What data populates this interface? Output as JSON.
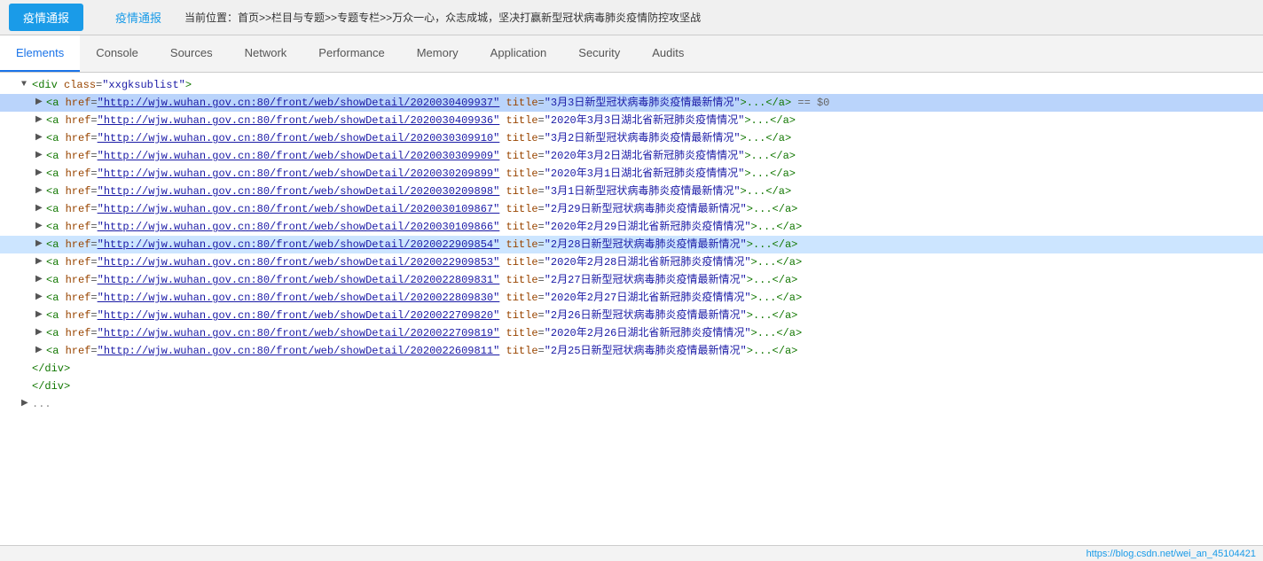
{
  "browser": {
    "tab_active_label": "疫情通报",
    "tab_inactive_label": "疫情通报",
    "breadcrumb": "当前位置：首页>>栏目与专题>>专题专栏>>万众一心，众志成城，坚决打赢新型冠状病毒肺炎疫情防控攻坚战"
  },
  "devtools": {
    "tabs": [
      {
        "id": "elements",
        "label": "Elements",
        "active": true
      },
      {
        "id": "console",
        "label": "Console",
        "active": false
      },
      {
        "id": "sources",
        "label": "Sources",
        "active": false
      },
      {
        "id": "network",
        "label": "Network",
        "active": false
      },
      {
        "id": "performance",
        "label": "Performance",
        "active": false
      },
      {
        "id": "memory",
        "label": "Memory",
        "active": false
      },
      {
        "id": "application",
        "label": "Application",
        "active": false
      },
      {
        "id": "security",
        "label": "Security",
        "active": false
      },
      {
        "id": "audits",
        "label": "Audits",
        "active": false
      }
    ]
  },
  "dom": {
    "lines": [
      {
        "indent": 1,
        "triangle": "open",
        "html": "<span class='tag-bracket'>&lt;</span><span class='tag'>div</span> <span class='attr-name'>class</span><span class='equals-sign'>=</span><span class='attr-value'>\"xxgksublist\"</span><span class='tag-bracket'>&gt;</span>",
        "selected": false
      },
      {
        "indent": 2,
        "triangle": "closed",
        "html": "<span class='tag-bracket'>&lt;</span><span class='tag'>a</span> <span class='attr-name'>href</span><span class='equals-sign'>=</span><span class='attr-value-link'>\"http://wjw.wuhan.gov.cn:80/front/web/showDetail/2020030409937\"</span> <span class='attr-name'>title</span><span class='equals-sign'>=</span><span class='attr-value'>\"3月3日新型冠状病毒肺炎疫情最新情况\"</span><span class='tag-bracket'>&gt;...&lt;/</span><span class='tag'>a</span><span class='tag-bracket'>&gt;</span> <span class='equals-dollar'>== $0</span>",
        "selected": true
      },
      {
        "indent": 2,
        "triangle": "closed",
        "html": "<span class='tag-bracket'>&lt;</span><span class='tag'>a</span> <span class='attr-name'>href</span><span class='equals-sign'>=</span><span class='attr-value-link'>\"http://wjw.wuhan.gov.cn:80/front/web/showDetail/2020030409936\"</span> <span class='attr-name'>title</span><span class='equals-sign'>=</span><span class='attr-value'>\"2020年3月3日湖北省新冠肺炎疫情情况\"</span><span class='tag-bracket'>&gt;...&lt;/</span><span class='tag'>a</span><span class='tag-bracket'>&gt;</span>",
        "selected": false
      },
      {
        "indent": 2,
        "triangle": "closed",
        "html": "<span class='tag-bracket'>&lt;</span><span class='tag'>a</span> <span class='attr-name'>href</span><span class='equals-sign'>=</span><span class='attr-value-link'>\"http://wjw.wuhan.gov.cn:80/front/web/showDetail/2020030309910\"</span> <span class='attr-name'>title</span><span class='equals-sign'>=</span><span class='attr-value'>\"3月2日新型冠状病毒肺炎疫情最新情况\"</span><span class='tag-bracket'>&gt;...&lt;/</span><span class='tag'>a</span><span class='tag-bracket'>&gt;</span>",
        "selected": false
      },
      {
        "indent": 2,
        "triangle": "closed",
        "html": "<span class='tag-bracket'>&lt;</span><span class='tag'>a</span> <span class='attr-name'>href</span><span class='equals-sign'>=</span><span class='attr-value-link'>\"http://wjw.wuhan.gov.cn:80/front/web/showDetail/2020030309909\"</span> <span class='attr-name'>title</span><span class='equals-sign'>=</span><span class='attr-value'>\"2020年3月2日湖北省新冠肺炎疫情情况\"</span><span class='tag-bracket'>&gt;...&lt;/</span><span class='tag'>a</span><span class='tag-bracket'>&gt;</span>",
        "selected": false
      },
      {
        "indent": 2,
        "triangle": "closed",
        "html": "<span class='tag-bracket'>&lt;</span><span class='tag'>a</span> <span class='attr-name'>href</span><span class='equals-sign'>=</span><span class='attr-value-link'>\"http://wjw.wuhan.gov.cn:80/front/web/showDetail/2020030209899\"</span> <span class='attr-name'>title</span><span class='equals-sign'>=</span><span class='attr-value'>\"2020年3月1日湖北省新冠肺炎疫情情况\"</span><span class='tag-bracket'>&gt;...&lt;/</span><span class='tag'>a</span><span class='tag-bracket'>&gt;</span>",
        "selected": false
      },
      {
        "indent": 2,
        "triangle": "closed",
        "html": "<span class='tag-bracket'>&lt;</span><span class='tag'>a</span> <span class='attr-name'>href</span><span class='equals-sign'>=</span><span class='attr-value-link'>\"http://wjw.wuhan.gov.cn:80/front/web/showDetail/2020030209898\"</span> <span class='attr-name'>title</span><span class='equals-sign'>=</span><span class='attr-value'>\"3月1日新型冠状病毒肺炎疫情最新情况\"</span><span class='tag-bracket'>&gt;...&lt;/</span><span class='tag'>a</span><span class='tag-bracket'>&gt;</span>",
        "selected": false
      },
      {
        "indent": 2,
        "triangle": "closed",
        "html": "<span class='tag-bracket'>&lt;</span><span class='tag'>a</span> <span class='attr-name'>href</span><span class='equals-sign'>=</span><span class='attr-value-link'>\"http://wjw.wuhan.gov.cn:80/front/web/showDetail/2020030109867\"</span> <span class='attr-name'>title</span><span class='equals-sign'>=</span><span class='attr-value'>\"2月29日新型冠状病毒肺炎疫情最新情况\"</span><span class='tag-bracket'>&gt;...&lt;/</span><span class='tag'>a</span><span class='tag-bracket'>&gt;</span>",
        "selected": false
      },
      {
        "indent": 2,
        "triangle": "closed",
        "html": "<span class='tag-bracket'>&lt;</span><span class='tag'>a</span> <span class='attr-name'>href</span><span class='equals-sign'>=</span><span class='attr-value-link'>\"http://wjw.wuhan.gov.cn:80/front/web/showDetail/2020030109866\"</span> <span class='attr-name'>title</span><span class='equals-sign'>=</span><span class='attr-value'>\"2020年2月29日湖北省新冠肺炎疫情情况\"</span><span class='tag-bracket'>&gt;...&lt;/</span><span class='tag'>a</span><span class='tag-bracket'>&gt;</span>",
        "selected": false
      },
      {
        "indent": 2,
        "triangle": "closed",
        "html": "<span class='tag-bracket'>&lt;</span><span class='tag'>a</span> <span class='attr-name'>href</span><span class='equals-sign'>=</span><span class='attr-value-link'>\"http://wjw.wuhan.gov.cn:80/front/web/showDetail/2020022909854\"</span> <span class='attr-name'>title</span><span class='equals-sign'>=</span><span class='attr-value'>\"2月28日新型冠状病毒肺炎疫情最新情况\"</span><span class='tag-bracket'>&gt;...&lt;/</span><span class='tag'>a</span><span class='tag-bracket'>&gt;</span>",
        "selected": "highlight"
      },
      {
        "indent": 2,
        "triangle": "closed",
        "html": "<span class='tag-bracket'>&lt;</span><span class='tag'>a</span> <span class='attr-name'>href</span><span class='equals-sign'>=</span><span class='attr-value-link'>\"http://wjw.wuhan.gov.cn:80/front/web/showDetail/2020022909853\"</span> <span class='attr-name'>title</span><span class='equals-sign'>=</span><span class='attr-value'>\"2020年2月28日湖北省新冠肺炎疫情情况\"</span><span class='tag-bracket'>&gt;...&lt;/</span><span class='tag'>a</span><span class='tag-bracket'>&gt;</span>",
        "selected": false
      },
      {
        "indent": 2,
        "triangle": "closed",
        "html": "<span class='tag-bracket'>&lt;</span><span class='tag'>a</span> <span class='attr-name'>href</span><span class='equals-sign'>=</span><span class='attr-value-link'>\"http://wjw.wuhan.gov.cn:80/front/web/showDetail/2020022809831\"</span> <span class='attr-name'>title</span><span class='equals-sign'>=</span><span class='attr-value'>\"2月27日新型冠状病毒肺炎疫情最新情况\"</span><span class='tag-bracket'>&gt;...&lt;/</span><span class='tag'>a</span><span class='tag-bracket'>&gt;</span>",
        "selected": false
      },
      {
        "indent": 2,
        "triangle": "closed",
        "html": "<span class='tag-bracket'>&lt;</span><span class='tag'>a</span> <span class='attr-name'>href</span><span class='equals-sign'>=</span><span class='attr-value-link'>\"http://wjw.wuhan.gov.cn:80/front/web/showDetail/2020022809830\"</span> <span class='attr-name'>title</span><span class='equals-sign'>=</span><span class='attr-value'>\"2020年2月27日湖北省新冠肺炎疫情情况\"</span><span class='tag-bracket'>&gt;...&lt;/</span><span class='tag'>a</span><span class='tag-bracket'>&gt;</span>",
        "selected": false
      },
      {
        "indent": 2,
        "triangle": "closed",
        "html": "<span class='tag-bracket'>&lt;</span><span class='tag'>a</span> <span class='attr-name'>href</span><span class='equals-sign'>=</span><span class='attr-value-link'>\"http://wjw.wuhan.gov.cn:80/front/web/showDetail/2020022709820\"</span> <span class='attr-name'>title</span><span class='equals-sign'>=</span><span class='attr-value'>\"2月26日新型冠状病毒肺炎疫情最新情况\"</span><span class='tag-bracket'>&gt;...&lt;/</span><span class='tag'>a</span><span class='tag-bracket'>&gt;</span>",
        "selected": false
      },
      {
        "indent": 2,
        "triangle": "closed",
        "html": "<span class='tag-bracket'>&lt;</span><span class='tag'>a</span> <span class='attr-name'>href</span><span class='equals-sign'>=</span><span class='attr-value-link'>\"http://wjw.wuhan.gov.cn:80/front/web/showDetail/2020022709819\"</span> <span class='attr-name'>title</span><span class='equals-sign'>=</span><span class='attr-value'>\"2020年2月26日湖北省新冠肺炎疫情情况\"</span><span class='tag-bracket'>&gt;...&lt;/</span><span class='tag'>a</span><span class='tag-bracket'>&gt;</span>",
        "selected": false
      },
      {
        "indent": 2,
        "triangle": "closed",
        "html": "<span class='tag-bracket'>&lt;</span><span class='tag'>a</span> <span class='attr-name'>href</span><span class='equals-sign'>=</span><span class='attr-value-link'>\"http://wjw.wuhan.gov.cn:80/front/web/showDetail/2020022609811\"</span> <span class='attr-name'>title</span><span class='equals-sign'>=</span><span class='attr-value'>\"2月25日新型冠状病毒肺炎疫情最新情况\"</span><span class='tag-bracket'>&gt;...&lt;/</span><span class='tag'>a</span><span class='tag-bracket'>&gt;</span>",
        "selected": false
      },
      {
        "indent": 1,
        "triangle": "leaf",
        "html": "<span class='tag-bracket'>&lt;/</span><span class='tag'>div</span><span class='tag-bracket'>&gt;</span>",
        "selected": false
      },
      {
        "indent": 1,
        "triangle": "leaf",
        "html": "<span class='tag-bracket'>&lt;/</span><span class='tag'>div</span><span class='tag-bracket'>&gt;</span>",
        "selected": false
      },
      {
        "indent": 1,
        "triangle": "closed",
        "html": "<span class='comment-text'>...</span>",
        "selected": false
      }
    ]
  },
  "statusbar": {
    "text": "https://blog.csdn.net/wei_an_45104421"
  }
}
